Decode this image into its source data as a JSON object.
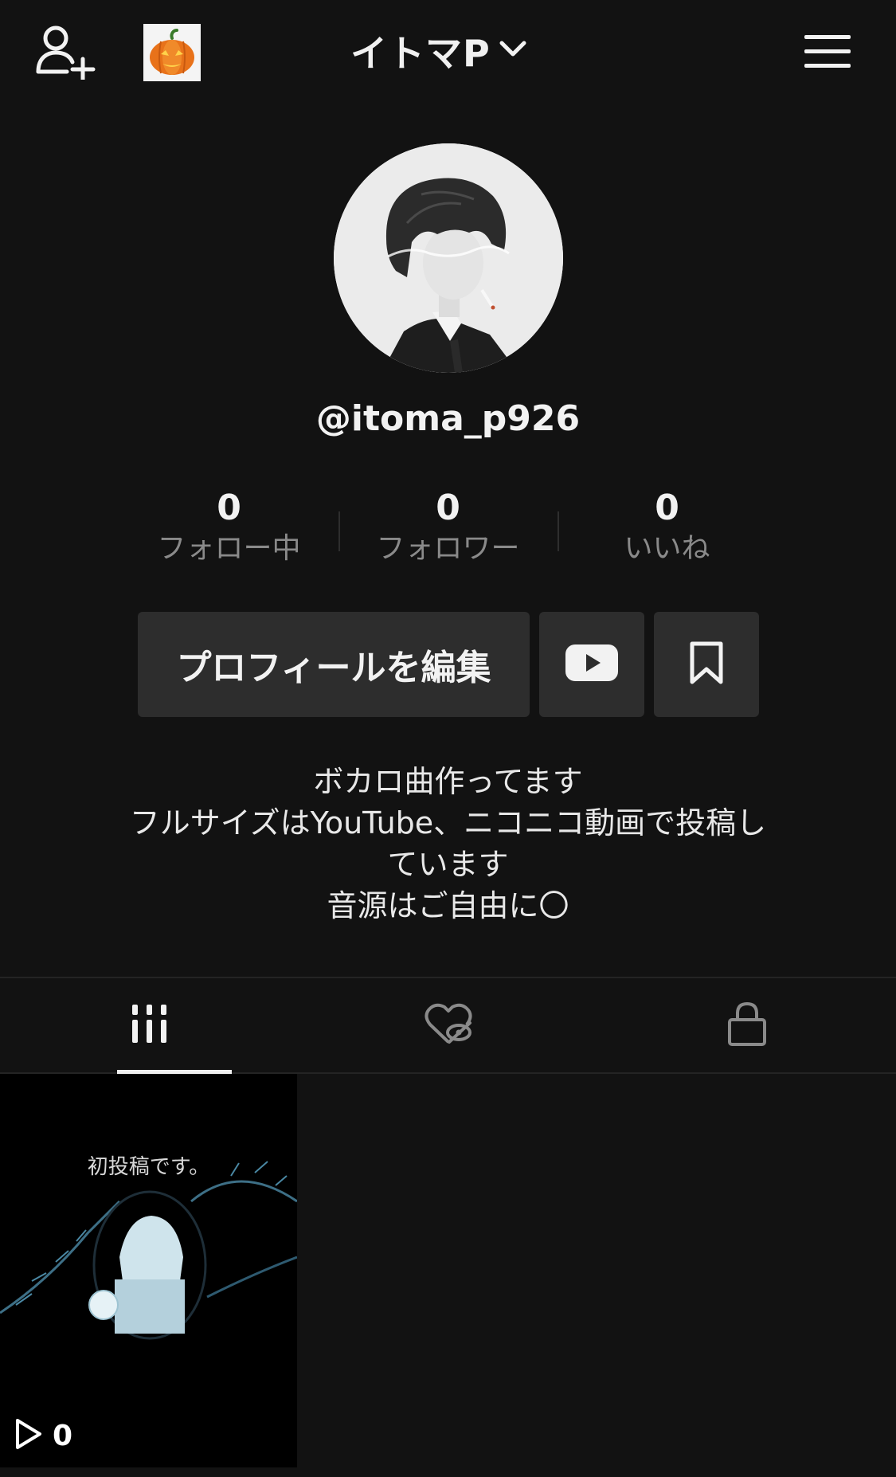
{
  "header": {
    "account_name": "イトマP",
    "add_friend_icon": "person-add-icon",
    "account_icon": "pumpkin-icon",
    "dropdown_icon": "chevron-down-icon",
    "menu_icon": "hamburger-menu-icon"
  },
  "profile": {
    "username": "@itoma_p926",
    "avatar_icon": "avatar-illustration"
  },
  "stats": [
    {
      "value": "0",
      "label": "フォロー中"
    },
    {
      "value": "0",
      "label": "フォロワー"
    },
    {
      "value": "0",
      "label": "いいね"
    }
  ],
  "actions": {
    "edit_profile_label": "プロフィールを編集",
    "youtube_icon": "youtube-icon",
    "bookmark_icon": "bookmark-icon"
  },
  "bio": {
    "lines": [
      "ボカロ曲作ってます",
      "フルサイズはYouTube、ニコニコ動画で投稿し",
      "ています",
      "音源はご自由に〇"
    ]
  },
  "tabs": [
    {
      "icon": "grid-videos-icon",
      "active": true
    },
    {
      "icon": "liked-hidden-icon",
      "active": false
    },
    {
      "icon": "lock-icon",
      "active": false
    }
  ],
  "videos": [
    {
      "caption": "初投稿です。",
      "views": "0",
      "play_icon": "play-icon"
    }
  ],
  "colors": {
    "background": "#121212",
    "button": "#2d2d2d",
    "secondary_text": "#8a8a8a"
  }
}
